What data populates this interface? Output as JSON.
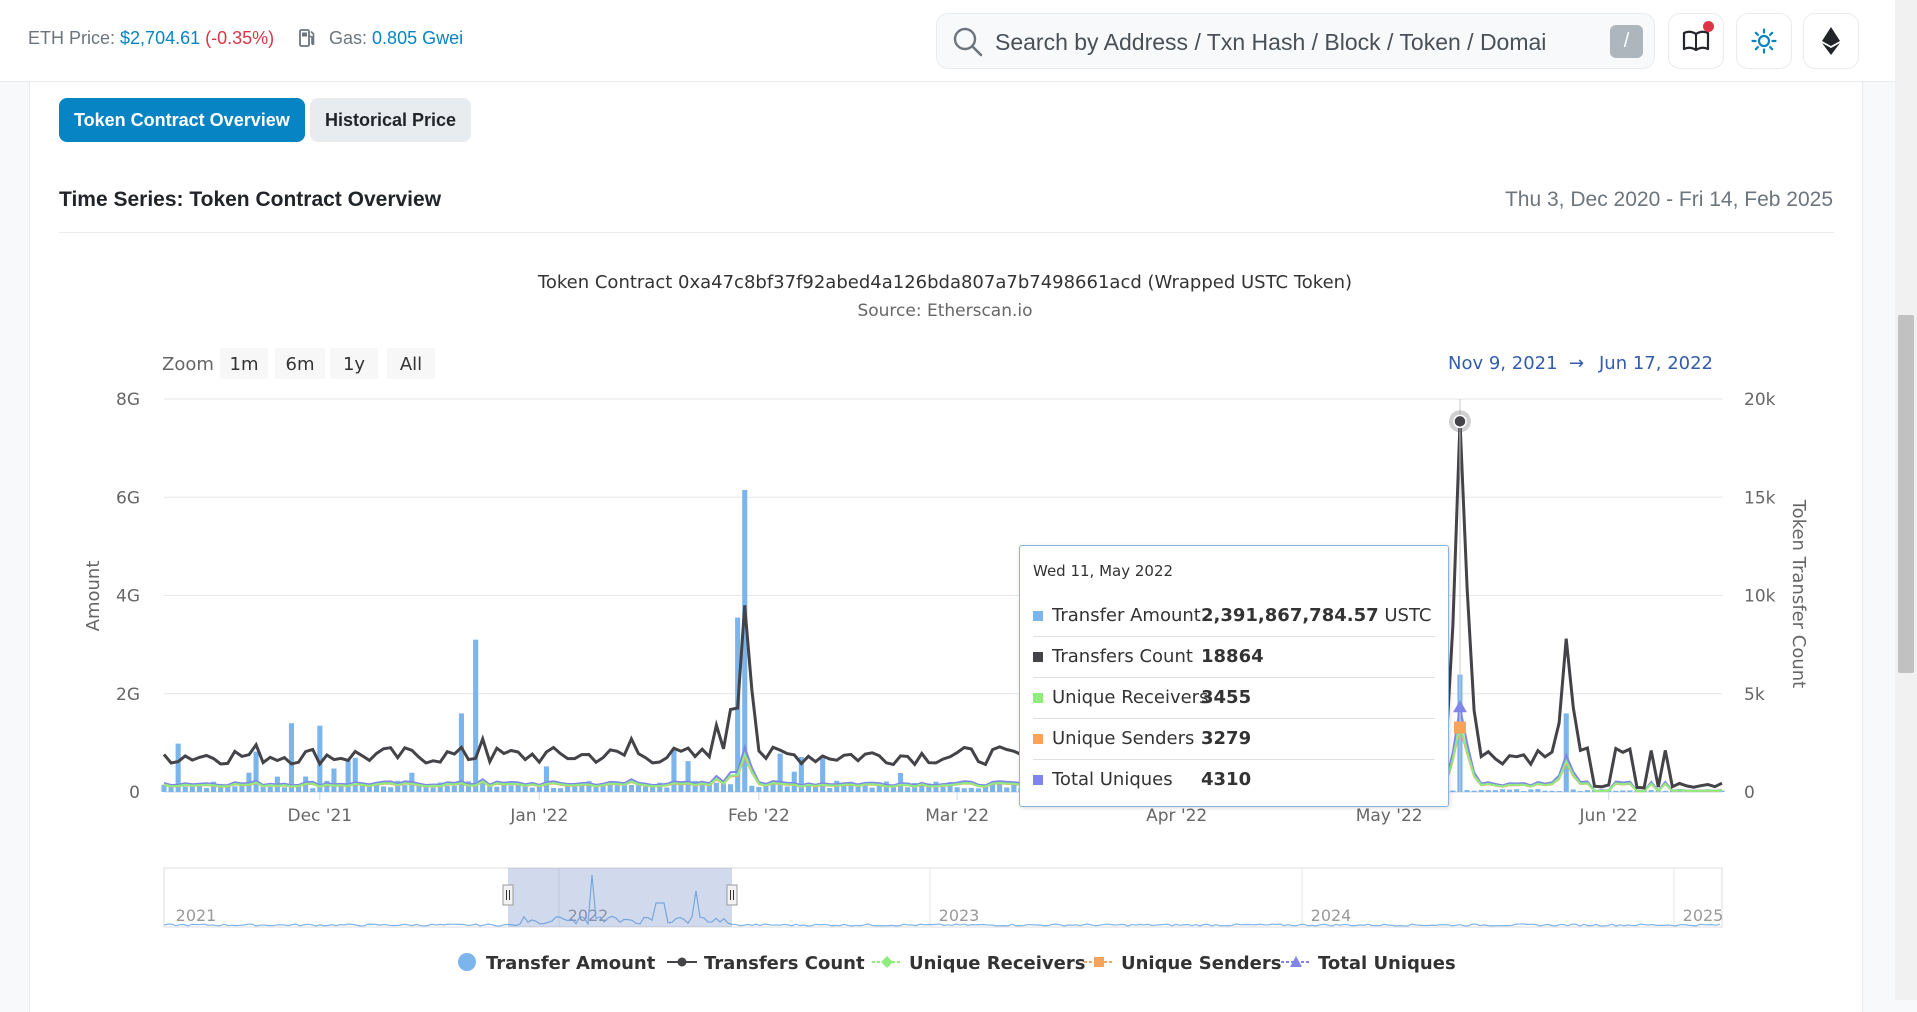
{
  "header": {
    "eth_price_label": "ETH Price:",
    "eth_price_value": "$2,704.61",
    "eth_price_change": "(-0.35%)",
    "gas_label": "Gas:",
    "gas_value": "0.805 Gwei",
    "search_placeholder": "Search by Address / Txn Hash / Block / Token / Domai",
    "search_shortcut": "/",
    "icons": [
      "gas-pump-icon",
      "search-icon",
      "book-icon",
      "sun-icon",
      "ethereum-icon"
    ]
  },
  "tabs": [
    {
      "label": "Token Contract Overview",
      "active": true
    },
    {
      "label": "Historical Price",
      "active": false
    }
  ],
  "section": {
    "title": "Time Series: Token Contract Overview",
    "date_range": "Thu 3, Dec 2020 - Fri 14, Feb 2025"
  },
  "chart": {
    "title": "Token Contract 0xa47c8bf37f92abed4a126bda807a7b7498661acd (Wrapped USTC Token)",
    "subtitle": "Source: Etherscan.io",
    "zoom_label": "Zoom",
    "zoom_buttons": [
      "1m",
      "6m",
      "1y",
      "All"
    ],
    "range_from": "Nov 9, 2021",
    "range_arrow": "→",
    "range_to": "Jun 17, 2022",
    "navigator_years": [
      "2021",
      "2022",
      "2023",
      "2024",
      "2025"
    ],
    "legend": [
      {
        "name": "Transfer Amount",
        "color": "#7cb5ec",
        "marker": "circle"
      },
      {
        "name": "Transfers Count",
        "color": "#434348",
        "marker": "circle-line"
      },
      {
        "name": "Unique Receivers",
        "color": "#90ed7d",
        "marker": "diamond-line"
      },
      {
        "name": "Unique Senders",
        "color": "#f7a35c",
        "marker": "square-line"
      },
      {
        "name": "Total Uniques",
        "color": "#8085e9",
        "marker": "triangle-line"
      }
    ]
  },
  "chart_data": {
    "type": "bar",
    "x_range": [
      "2021-11-09",
      "2022-06-17"
    ],
    "x_ticks": [
      "Dec '21",
      "Jan '22",
      "Feb '22",
      "Mar '22",
      "Apr '22",
      "May '22",
      "Jun '22"
    ],
    "y_left": {
      "label": "Amount",
      "ticks": [
        "0",
        "2G",
        "4G",
        "6G",
        "8G"
      ],
      "range": [
        0,
        8000000000
      ]
    },
    "y_right": {
      "label": "Token Transfer Count",
      "ticks": [
        "0",
        "5k",
        "10k",
        "15k",
        "20k"
      ],
      "range": [
        0,
        20000
      ]
    },
    "grid": true,
    "legend_position": "bottom",
    "series": [
      {
        "name": "Transfer Amount",
        "axis": "left",
        "type": "column",
        "values_note": "daily",
        "peaks": [
          {
            "date": "2021-11-27",
            "value": 1400000000
          },
          {
            "date": "2021-12-01",
            "value": 1350000000
          },
          {
            "date": "2021-12-21",
            "value": 1600000000
          },
          {
            "date": "2021-12-23",
            "value": 3100000000
          },
          {
            "date": "2022-01-29",
            "value": 3550000000
          },
          {
            "date": "2022-01-30",
            "value": 6150000000
          },
          {
            "date": "2022-05-11",
            "value": 2391867784.57
          },
          {
            "date": "2022-05-26",
            "value": 1600000000
          }
        ]
      },
      {
        "name": "Transfers Count",
        "axis": "right",
        "type": "line",
        "peaks": [
          {
            "date": "2022-01-30",
            "value": 9500
          },
          {
            "date": "2022-05-11",
            "value": 18864
          },
          {
            "date": "2022-05-26",
            "value": 7800
          }
        ]
      },
      {
        "name": "Unique Receivers",
        "axis": "right",
        "type": "line",
        "peaks": [
          {
            "date": "2022-05-11",
            "value": 3455
          }
        ]
      },
      {
        "name": "Unique Senders",
        "axis": "right",
        "type": "line",
        "peaks": [
          {
            "date": "2022-05-11",
            "value": 3279
          }
        ]
      },
      {
        "name": "Total Uniques",
        "axis": "right",
        "type": "line",
        "peaks": [
          {
            "date": "2022-05-11",
            "value": 4310
          }
        ]
      }
    ]
  },
  "tooltip": {
    "date": "Wed 11, May 2022",
    "rows": [
      {
        "label": "Transfer Amount",
        "value": "2,391,867,784.57",
        "unit": "USTC",
        "color": "#7cb5ec"
      },
      {
        "label": "Transfers Count",
        "value": "18864",
        "unit": "",
        "color": "#434348"
      },
      {
        "label": "Unique Receivers",
        "value": "3455",
        "unit": "",
        "color": "#90ed7d"
      },
      {
        "label": "Unique Senders",
        "value": "3279",
        "unit": "",
        "color": "#f7a35c"
      },
      {
        "label": "Total Uniques",
        "value": "4310",
        "unit": "",
        "color": "#8085e9"
      }
    ]
  }
}
